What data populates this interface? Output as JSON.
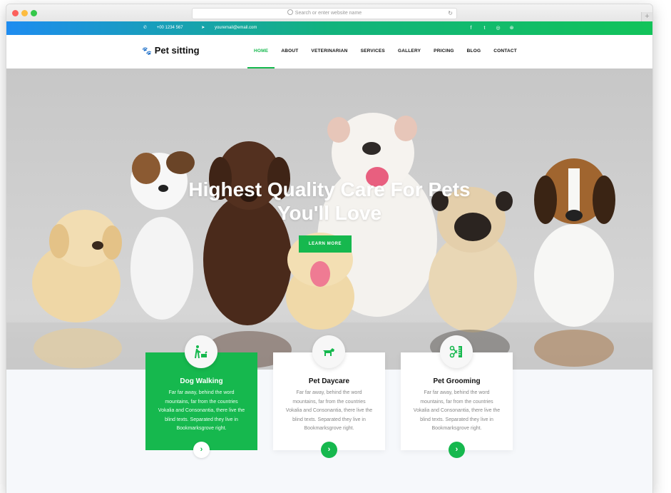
{
  "browser": {
    "url_placeholder": "Search or enter website name",
    "new_tab_glyph": "+"
  },
  "topbar": {
    "phone": "+00 1234 567",
    "email": "youremail@email.com",
    "socials": [
      "facebook-icon",
      "twitter-icon",
      "instagram-icon",
      "dribbble-icon"
    ]
  },
  "nav": {
    "logo": "Pet sitting",
    "items": [
      "HOME",
      "ABOUT",
      "VETERINARIAN",
      "SERVICES",
      "GALLERY",
      "PRICING",
      "BLOG",
      "CONTACT"
    ],
    "active": "HOME"
  },
  "hero": {
    "title_line1": "Highest Quality Care For Pets",
    "title_line2": "You'll Love",
    "button": "LEARN MORE"
  },
  "services": [
    {
      "title": "Dog Walking",
      "desc": "Far far away, behind the word mountains, far from the countries Vokalia and Consonantia, there live the blind texts. Separated they live in Bookmarksgrove right.",
      "icon": "dog-walking-icon",
      "highlight": true
    },
    {
      "title": "Pet Daycare",
      "desc": "Far far away, behind the word mountains, far from the countries Vokalia and Consonantia, there live the blind texts. Separated they live in Bookmarksgrove right.",
      "icon": "dog-icon",
      "highlight": false
    },
    {
      "title": "Pet Grooming",
      "desc": "Far far away, behind the word mountains, far from the countries Vokalia and Consonantia, there live the blind texts. Separated they live in Bookmarksgrove right.",
      "icon": "grooming-scissors-icon",
      "highlight": false
    }
  ],
  "colors": {
    "accent": "#16b84e",
    "topbar_start": "#1e8cf0",
    "topbar_end": "#12c35a"
  }
}
